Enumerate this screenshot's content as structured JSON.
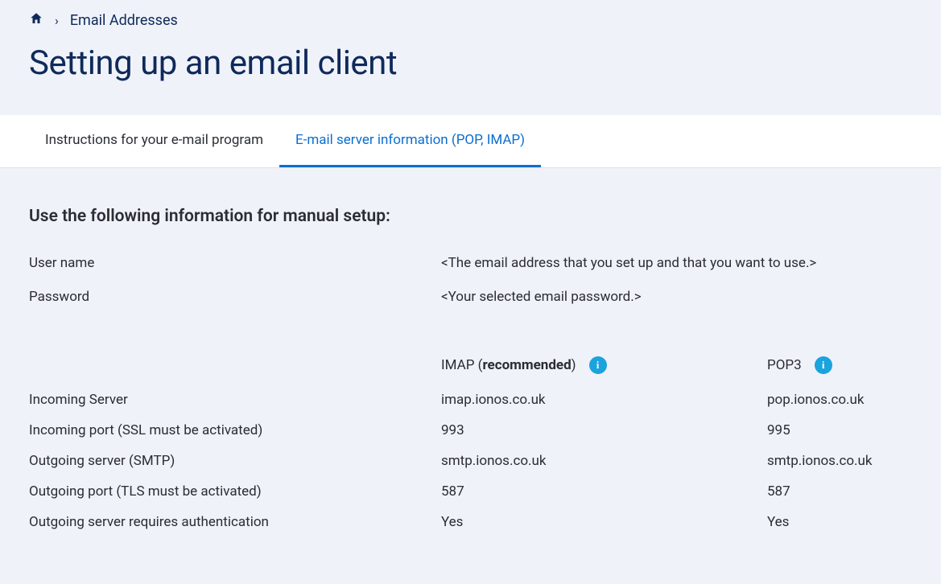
{
  "breadcrumb": {
    "link_label": "Email Addresses"
  },
  "page": {
    "title": "Setting up an email client"
  },
  "tabs": {
    "instructions": "Instructions for your e-mail program",
    "server_info": "E-mail server information (POP, IMAP)"
  },
  "section": {
    "heading": "Use the following information for manual setup:"
  },
  "credentials": {
    "username_label": "User name",
    "username_value": "<The email address that you set up and that you want to use.>",
    "password_label": "Password",
    "password_value": "<Your selected email password.>"
  },
  "server": {
    "imap_label_prefix": "IMAP (",
    "imap_recommended": "recommended",
    "imap_label_suffix": ")",
    "pop3_label": "POP3",
    "rows": {
      "incoming_server": {
        "label": "Incoming Server",
        "imap": "imap.ionos.co.uk",
        "pop3": "pop.ionos.co.uk"
      },
      "incoming_port": {
        "label": "Incoming port (SSL must be activated)",
        "imap": "993",
        "pop3": "995"
      },
      "outgoing_server": {
        "label": "Outgoing server (SMTP)",
        "imap": "smtp.ionos.co.uk",
        "pop3": "smtp.ionos.co.uk"
      },
      "outgoing_port": {
        "label": "Outgoing port (TLS must be activated)",
        "imap": "587",
        "pop3": "587"
      },
      "auth": {
        "label": "Outgoing server requires authentication",
        "imap": "Yes",
        "pop3": "Yes"
      }
    }
  },
  "icons": {
    "info_glyph": "i"
  }
}
